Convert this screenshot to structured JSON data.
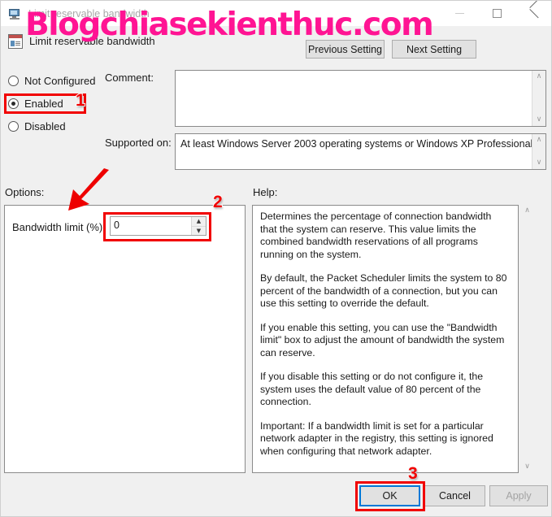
{
  "window": {
    "title": "Limit reservable bandwidth",
    "title_icon": "monitor-icon",
    "minimize_label": "—",
    "maximize_label": "☐",
    "close_label": "✕"
  },
  "header": {
    "setting_name": "Limit reservable bandwidth",
    "setting_icon": "policy-setting-icon",
    "previous_setting": "Previous Setting",
    "next_setting": "Next Setting"
  },
  "state": {
    "options": [
      {
        "label": "Not Configured",
        "selected": false
      },
      {
        "label": "Enabled",
        "selected": true
      },
      {
        "label": "Disabled",
        "selected": false
      }
    ]
  },
  "comment": {
    "label": "Comment:",
    "value": ""
  },
  "supported_on": {
    "label": "Supported on:",
    "value": "At least Windows Server 2003 operating systems or Windows XP Professional"
  },
  "options_panel": {
    "label": "Options:",
    "bandwidth_label": "Bandwidth limit (%):",
    "bandwidth_value": "0",
    "spin_up": "▲",
    "spin_down": "▼"
  },
  "help_panel": {
    "label": "Help:",
    "paragraphs": [
      "Determines the percentage of connection bandwidth that the system can reserve. This value limits the combined bandwidth reservations of all programs running on the system.",
      "By default, the Packet Scheduler limits the system to 80 percent of the bandwidth of a connection, but you can use this setting to override the default.",
      "If you enable this setting, you can use the \"Bandwidth limit\" box to adjust the amount of bandwidth the system can reserve.",
      "If you disable this setting or do not configure it, the system uses the default value of 80 percent of the connection.",
      "Important: If a bandwidth limit is set for a particular network adapter in the registry, this setting is ignored when configuring that network adapter."
    ]
  },
  "scrollbars": {
    "arrow_up": "∧",
    "arrow_down": "∨"
  },
  "footer": {
    "ok": "OK",
    "cancel": "Cancel",
    "apply": "Apply",
    "apply_disabled": true
  },
  "annotations": {
    "badge_1": "1",
    "badge_2": "2",
    "badge_3": "3",
    "highlight_color": "#f10000",
    "arrow": "red-arrow-pointing-down-left"
  },
  "watermark": {
    "text": "Blogchiasekienthuc.com",
    "color": "#ff1493"
  }
}
